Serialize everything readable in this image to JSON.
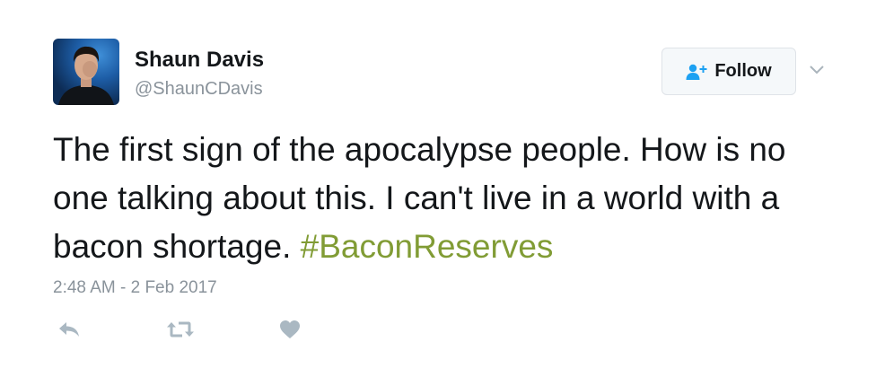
{
  "user": {
    "name": "Shaun Davis",
    "handle": "@ShaunCDavis"
  },
  "follow_button": {
    "label": "Follow",
    "icon": "add-user-icon"
  },
  "menu_icon": "chevron-down-icon",
  "tweet": {
    "text": "The first sign of the apocalypse people. How is no one talking about this. I can't live in a world with a bacon shortage.",
    "hashtag": "#BaconReserves"
  },
  "timestamp": "2:48 AM - 2 Feb 2017",
  "actions": {
    "reply_icon": "reply-icon",
    "retweet_icon": "retweet-icon",
    "like_icon": "heart-icon"
  },
  "colors": {
    "hashtag": "#819c35",
    "follow_icon": "#1da1f2",
    "muted": "#8a939b",
    "text": "#14171a"
  }
}
